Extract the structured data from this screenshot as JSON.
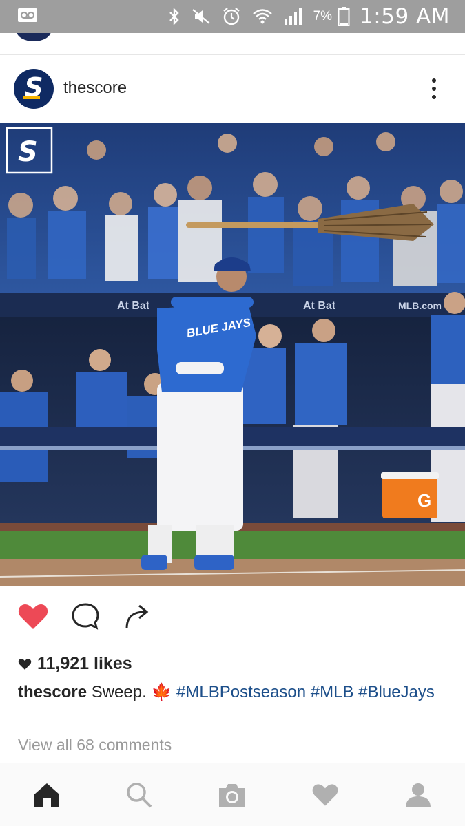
{
  "status_bar": {
    "battery_percent": "7%",
    "time": "1:59 AM",
    "icons": [
      "voicemail-icon",
      "bluetooth-icon",
      "mute-icon",
      "alarm-icon",
      "wifi-icon",
      "signal-icon",
      "battery-icon"
    ]
  },
  "post": {
    "username": "thescore",
    "avatar_letter": "S",
    "watermark_letter": "S",
    "photo_text": {
      "banner_left": "At Bat",
      "banner_mid": "At Bat",
      "banner_right": "MLB.com",
      "jersey": "BLUE JAYS",
      "cooler": "G"
    },
    "liked": true,
    "likes": "11,921 likes",
    "caption_user": "thescore",
    "caption_text": "Sweep.",
    "caption_emoji": "🍁",
    "hashtags": [
      "#MLBPostseason",
      "#MLB",
      "#BlueJays"
    ],
    "comments_link": "View all 68 comments"
  },
  "colors": {
    "like_red": "#ed4956",
    "hashtag_blue": "#1d4f8a",
    "brand_navy": "#0f2a63",
    "brand_gold": "#f5b300"
  },
  "bottom_nav": [
    "home-icon",
    "search-icon",
    "camera-icon",
    "heart-icon",
    "profile-icon"
  ]
}
